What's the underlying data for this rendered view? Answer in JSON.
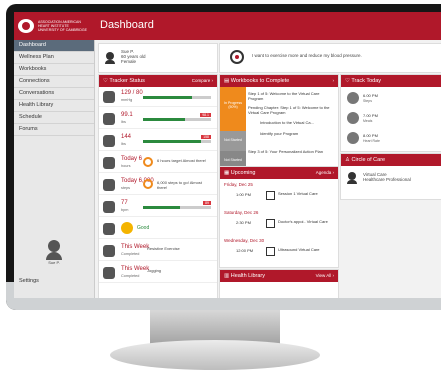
{
  "header": {
    "title": "Dashboard",
    "logo_lines": [
      "ASSOCIATION AMERICAN",
      "HEART INSTITUTE",
      "UNIVERSITY OF CAMBRIDGE"
    ]
  },
  "sidebar": {
    "items": [
      {
        "label": "Dashboard",
        "active": true
      },
      {
        "label": "Wellness Plan",
        "active": false
      },
      {
        "label": "Workbooks",
        "active": false
      },
      {
        "label": "Connections",
        "active": false
      },
      {
        "label": "Conversations",
        "active": false
      },
      {
        "label": "Health Library",
        "active": false
      },
      {
        "label": "Schedule",
        "active": false
      },
      {
        "label": "Forums",
        "active": false
      }
    ],
    "user_name": "Sue P.",
    "settings_label": "Settings"
  },
  "profile": {
    "name": "Sue P.",
    "age": "60 years old",
    "gender": "Female"
  },
  "goal": {
    "text": "I want to exercise more and reduce my blood pressure."
  },
  "tracker": {
    "title": "Tracker Status",
    "link": "Compare",
    "rows": [
      {
        "value": "129 / 80",
        "label": "mmHg",
        "badge": "",
        "fill": 0.72
      },
      {
        "value": "99.1",
        "label": "lbs",
        "badge": "98.1",
        "fill": 0.62
      },
      {
        "value": "144",
        "label": "lbs",
        "badge": "158",
        "fill": 0.86
      },
      {
        "value": "Today 6",
        "label": "hours",
        "ring_text": "6 hours target Almost there!",
        "ring": "60%"
      },
      {
        "value": "Today 6,000",
        "label": "steps",
        "ring_text": "6,000 steps to go! Almost there!",
        "ring": "60%"
      },
      {
        "value": "77",
        "label": "bpm",
        "badge": "89",
        "fill": 0.55
      },
      {
        "value": "",
        "label": "",
        "mood": "Good"
      },
      {
        "value": "This Week",
        "label": "Completed",
        "activity": "Resistive Exercise"
      },
      {
        "value": "This Week",
        "label": "Completed",
        "activity": "Jogging"
      }
    ],
    "colors": {
      "good": "#2b8a3e",
      "bad": "#d9363e"
    }
  },
  "workbooks": {
    "title": "Workbooks to Complete",
    "in_progress_label": "In Progress",
    "in_progress_pct": "(50%)",
    "items": [
      "Step 1 of 5: Welcome to the Virtual Care Program",
      "Pending Chapter: Step 1 of 5: Welcome to the Virtual Care Program",
      "Introduction to the Virtual Ca...",
      "Identify your Program",
      "Step 3 of 5: Your Personalized Action Plan",
      "Step 2 of 5: Tell Us About Yourself"
    ],
    "tags": [
      "Not Started",
      "Not Started"
    ]
  },
  "upcoming": {
    "title": "Upcoming",
    "link": "Agenda",
    "events": [
      {
        "day": "Friday, Dec 25",
        "time": "1:00 PM",
        "title": "Session 1 Virtual Care"
      },
      {
        "day": "Saturday, Dec 26",
        "time": "2:30 PM",
        "title": "Doctor's appoi.. Virtual Care"
      },
      {
        "day": "Wednesday, Dec 30",
        "time": "12:00 PM",
        "title": "Ultrasound Virtual Care"
      }
    ]
  },
  "health_library": {
    "title": "Health Library",
    "link": "View All"
  },
  "track_today": {
    "title": "Track Today",
    "items": [
      {
        "value": "6.00 PM",
        "label": "Steps"
      },
      {
        "value": "7.00 PM",
        "label": "Meals"
      },
      {
        "value": "8.00 PM",
        "label": "Heart Rate"
      }
    ]
  },
  "circle": {
    "title": "Circle of Care",
    "member_name": "Virtual Care",
    "member_role": "Healthcare Professional"
  }
}
